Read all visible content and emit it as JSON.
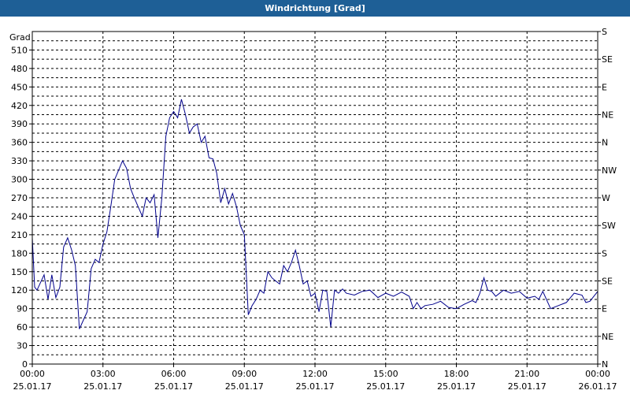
{
  "window": {
    "title": "Windrichtung [Grad]"
  },
  "chart_data": {
    "type": "line",
    "title": "Windrichtung [Grad]",
    "ylabel": "Grad",
    "ylim": [
      0,
      540
    ],
    "xlim": [
      0,
      24
    ],
    "grid": true,
    "y_ticks": [
      0,
      30,
      60,
      90,
      120,
      150,
      180,
      210,
      240,
      270,
      300,
      330,
      360,
      390,
      420,
      450,
      480,
      510
    ],
    "x_ticks": [
      {
        "x": 0,
        "time": "00:00",
        "date": "25.01.17"
      },
      {
        "x": 3,
        "time": "03:00",
        "date": "25.01.17"
      },
      {
        "x": 6,
        "time": "06:00",
        "date": "25.01.17"
      },
      {
        "x": 9,
        "time": "09:00",
        "date": "25.01.17"
      },
      {
        "x": 12,
        "time": "12:00",
        "date": "25.01.17"
      },
      {
        "x": 15,
        "time": "15:00",
        "date": "25.01.17"
      },
      {
        "x": 18,
        "time": "18:00",
        "date": "25.01.17"
      },
      {
        "x": 21,
        "time": "21:00",
        "date": "25.01.17"
      },
      {
        "x": 24,
        "time": "00:00",
        "date": "26.01.17"
      }
    ],
    "y2_ticks": [
      {
        "y": 0,
        "label": "N"
      },
      {
        "y": 45,
        "label": "NE"
      },
      {
        "y": 90,
        "label": "E"
      },
      {
        "y": 135,
        "label": "SE"
      },
      {
        "y": 180,
        "label": "S"
      },
      {
        "y": 225,
        "label": "SW"
      },
      {
        "y": 270,
        "label": "W"
      },
      {
        "y": 315,
        "label": "NW"
      },
      {
        "y": 360,
        "label": "N"
      },
      {
        "y": 405,
        "label": "NE"
      },
      {
        "y": 450,
        "label": "E"
      },
      {
        "y": 495,
        "label": "SE"
      },
      {
        "y": 540,
        "label": "S"
      }
    ],
    "series": [
      {
        "color": "#00008b",
        "x": [
          0,
          0.1,
          0.2,
          0.5,
          0.67,
          0.83,
          1.0,
          1.17,
          1.33,
          1.5,
          1.67,
          1.83,
          2.0,
          2.33,
          2.5,
          2.67,
          2.83,
          3.0,
          3.17,
          3.33,
          3.5,
          3.83,
          4.0,
          4.17,
          4.33,
          4.5,
          4.67,
          4.83,
          5.0,
          5.17,
          5.33,
          5.5,
          5.67,
          5.83,
          6.0,
          6.17,
          6.33,
          6.5,
          6.67,
          6.83,
          7.0,
          7.17,
          7.33,
          7.5,
          7.67,
          7.83,
          8.0,
          8.17,
          8.33,
          8.5,
          8.67,
          8.83,
          9.0,
          9.17,
          9.33,
          9.5,
          9.67,
          9.83,
          10.0,
          10.17,
          10.33,
          10.5,
          10.67,
          10.83,
          11.0,
          11.17,
          11.33,
          11.5,
          11.67,
          11.83,
          12.0,
          12.17,
          12.33,
          12.5,
          12.67,
          12.83,
          13.0,
          13.17,
          13.33,
          13.67,
          14.0,
          14.33,
          14.67,
          15.0,
          15.33,
          15.67,
          16.0,
          16.17,
          16.33,
          16.5,
          16.67,
          17.0,
          17.33,
          17.67,
          18.0,
          18.33,
          18.67,
          18.83,
          19.0,
          19.17,
          19.33,
          19.5,
          19.67,
          20.0,
          20.33,
          20.67,
          21.0,
          21.33,
          21.5,
          21.67,
          22.0,
          22.33,
          22.67,
          23.0,
          23.33,
          23.5,
          23.67,
          24.0
        ],
        "values": [
          205,
          125,
          120,
          145,
          105,
          145,
          108,
          125,
          190,
          205,
          185,
          160,
          57,
          85,
          155,
          170,
          165,
          195,
          215,
          255,
          300,
          330,
          318,
          285,
          270,
          255,
          240,
          270,
          262,
          275,
          205,
          270,
          370,
          400,
          410,
          400,
          430,
          405,
          375,
          385,
          390,
          360,
          370,
          335,
          333,
          310,
          262,
          285,
          260,
          277,
          255,
          225,
          210,
          80,
          95,
          105,
          120,
          115,
          150,
          140,
          135,
          130,
          160,
          150,
          165,
          185,
          160,
          130,
          135,
          110,
          115,
          85,
          120,
          118,
          60,
          120,
          115,
          122,
          115,
          112,
          118,
          120,
          108,
          115,
          110,
          117,
          110,
          90,
          100,
          90,
          95,
          97,
          102,
          92,
          90,
          97,
          103,
          100,
          115,
          140,
          120,
          118,
          110,
          120,
          115,
          118,
          107,
          110,
          105,
          118,
          90,
          95,
          100,
          115,
          112,
          100,
          102,
          118
        ]
      }
    ]
  }
}
